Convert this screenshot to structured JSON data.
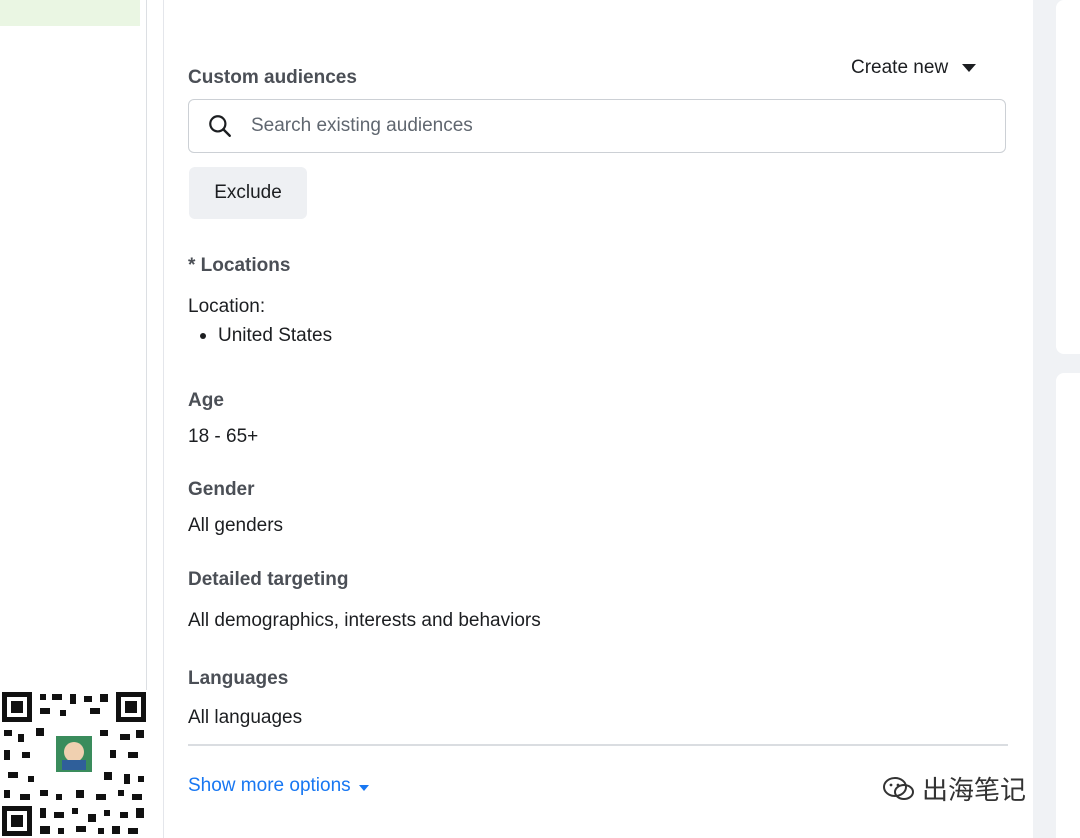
{
  "audience": {
    "custom_audiences_title": "Custom audiences",
    "create_new_label": "Create new",
    "search_placeholder": "Search existing audiences",
    "exclude_label": "Exclude"
  },
  "locations": {
    "title": "* Locations",
    "sub_label": "Location:",
    "items": [
      "United States"
    ]
  },
  "age": {
    "title": "Age",
    "value": "18 - 65+"
  },
  "gender": {
    "title": "Gender",
    "value": "All genders"
  },
  "detailed_targeting": {
    "title": "Detailed targeting",
    "value": "All demographics, interests and behaviors"
  },
  "languages": {
    "title": "Languages",
    "value": "All languages"
  },
  "show_more_label": "Show more options",
  "watermark": {
    "brand_text": "出海笔记"
  },
  "icons": {
    "search": "search-icon",
    "dropdown": "caret-down-icon",
    "qr": "qr-code-icon",
    "wechat": "wechat-icon"
  },
  "colors": {
    "link": "#1877f2",
    "text": "#1c1e21",
    "title": "#4b4f56",
    "button_bg": "#eef0f3"
  }
}
